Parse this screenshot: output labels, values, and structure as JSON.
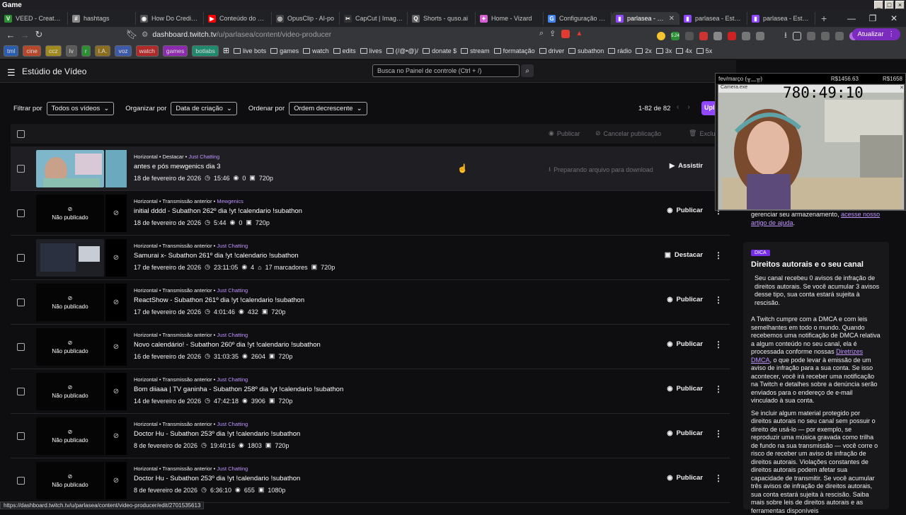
{
  "window": {
    "title": "Game"
  },
  "tabs": [
    {
      "label": "VEED - Create, Ed",
      "icon_color": "#2c8f34",
      "glyph": "V"
    },
    {
      "label": "hashtags",
      "icon_color": "#888888",
      "glyph": "#"
    },
    {
      "label": "How Do Credits W",
      "icon_color": "#555555",
      "glyph": "◉"
    },
    {
      "label": "Conteúdo do can",
      "icon_color": "#ff0000",
      "glyph": "▶"
    },
    {
      "label": "OpusClip - AI-po",
      "icon_color": "#444444",
      "glyph": "◎"
    },
    {
      "label": "CapCut | Image E",
      "icon_color": "#333333",
      "glyph": "✂"
    },
    {
      "label": "Shorts - quso.ai",
      "icon_color": "#666666",
      "glyph": "Q"
    },
    {
      "label": "Home - Vizard",
      "icon_color": "#d45fd4",
      "glyph": "✦"
    },
    {
      "label": "Configuração Me",
      "icon_color": "#4285f4",
      "glyph": "G"
    },
    {
      "label": "parlasea - Estú",
      "icon_color": "#9147ff",
      "glyph": "▮",
      "active": true
    },
    {
      "label": "parlasea - Estúdio",
      "icon_color": "#9147ff",
      "glyph": "▮"
    },
    {
      "label": "parlasea - Estúdio",
      "icon_color": "#9147ff",
      "glyph": "▮"
    }
  ],
  "address": {
    "host": "dashboard.twitch.tv",
    "path": "/u/parlasea/content/video-producer",
    "update_label": "Atualizar",
    "badge": "5.24"
  },
  "bookmarks": {
    "chips": [
      "tml",
      "cine",
      "ccz",
      "lv",
      "r",
      "I.A.",
      "voz",
      "watch",
      "games",
      "botlabs"
    ],
    "items": [
      "live bots",
      "games",
      "watch",
      "edits",
      "lives",
      "(/@•@)/",
      "donate $",
      "stream",
      "formatação",
      "driver",
      "subathon",
      "rádio",
      "2x",
      "3x",
      "4x",
      "5x"
    ]
  },
  "header": {
    "title": "Estúdio de Vídeo",
    "search_placeholder": "Busca no Painel de controle (Ctrl + /)"
  },
  "filters": {
    "filter_label": "Filtrar por",
    "filter_value": "Todos os vídeos",
    "organize_label": "Organizar por",
    "organize_value": "Data de criação",
    "order_label": "Ordenar por",
    "order_value": "Ordem decrescente",
    "page_count": "1-82 de 82",
    "upload_label": "Upl"
  },
  "bulk_actions": {
    "publish": "Publicar",
    "unpublish": "Cancelar publicação",
    "delete": "Exclu"
  },
  "videos": [
    {
      "category": "Horizontal • Destacar •",
      "game": "Just Chatting",
      "title": "antes e pós mewgenics dia 3",
      "date": "18 de fevereiro de 2026",
      "duration": "15:46",
      "views": "0",
      "markers": "",
      "quality": "720p",
      "action": "Assistir",
      "prep": "Preparando arquivo para download",
      "published": true
    },
    {
      "category": "Horizontal • Transmissão anterior •",
      "game": "Mewgenics",
      "title": "initial dddd - Subathon 262º dia !yt !calendario !subathon",
      "date": "18 de fevereiro de 2026",
      "duration": "5:44",
      "views": "0",
      "markers": "",
      "quality": "720p",
      "action": "Publicar",
      "published": false
    },
    {
      "category": "Horizontal • Transmissão anterior •",
      "game": "Just Chatting",
      "title": "Samurai x- Subathon 261º dia !yt !calendario !subathon",
      "date": "17 de fevereiro de 2026",
      "duration": "23:11:05",
      "views": "4",
      "markers": "17 marcadores",
      "quality": "720p",
      "action": "Destacar",
      "published": true
    },
    {
      "category": "Horizontal • Transmissão anterior •",
      "game": "Just Chatting",
      "title": "ReactShow - Subathon 261º dia !yt !calendario !subathon",
      "date": "17 de fevereiro de 2026",
      "duration": "4:01:46",
      "views": "432",
      "markers": "",
      "quality": "720p",
      "action": "Publicar",
      "published": false
    },
    {
      "category": "Horizontal • Transmissão anterior •",
      "game": "Just Chatting",
      "title": "Novo calendário! - Subathon 260º dia !yt !calendario !subathon",
      "date": "16 de fevereiro de 2026",
      "duration": "31:03:35",
      "views": "2604",
      "markers": "",
      "quality": "720p",
      "action": "Publicar",
      "published": false
    },
    {
      "category": "Horizontal • Transmissão anterior •",
      "game": "Just Chatting",
      "title": "Bom diiaaa | TV ganinha - Subathon 258º dia !yt !calendario !subathon",
      "date": "14 de fevereiro de 2026",
      "duration": "47:42:18",
      "views": "3906",
      "markers": "",
      "quality": "720p",
      "action": "Publicar",
      "published": false
    },
    {
      "category": "Horizontal • Transmissão anterior •",
      "game": "Just Chatting",
      "title": "Doctor Hu - Subathon 253º dia !yt !calendario !subathon",
      "date": "8 de fevereiro de 2026",
      "duration": "19:40:16",
      "views": "1803",
      "markers": "",
      "quality": "720p",
      "action": "Publicar",
      "published": false
    },
    {
      "category": "Horizontal • Transmissão anterior •",
      "game": "Just Chatting",
      "title": "Doctor Hu - Subathon 253º dia !yt !calendario !subathon",
      "date": "8 de fevereiro de 2026",
      "duration": "6:36:10",
      "views": "655",
      "markers": "",
      "quality": "1080p",
      "action": "Publicar",
      "published": false
    }
  ],
  "unpublished_label": "Não publicado",
  "side_panel": {
    "storage_text": "gerenciar seu armazenamento,",
    "storage_link": "acesse nosso artigo de ajuda",
    "tip_badge": "DICA",
    "title": "Direitos autorais e o seu canal",
    "p1": "Seu canal recebeu 0 avisos de infração de direitos autorais. Se você acumular 3 avisos desse tipo, sua conta estará sujeita à rescisão.",
    "p2a": "A Twitch cumpre com a DMCA e com leis semelhantes em todo o mundo. Quando recebemos uma notificação de DMCA relativa a algum conteúdo no seu canal, ela é processada conforme nossas",
    "p2link": "Diretrizes DMCA",
    "p2b": ", o que pode levar à emissão de um aviso de infração para a sua conta. Se isso acontecer, você irá receber uma notificação na Twitch e detalhes sobre a denúncia serão enviados para o endereço de e-mail vinculado à sua conta.",
    "p3": "Se incluir algum material protegido por direitos autorais no seu canal sem possuir o direito de usá-lo — por exemplo, se reproduzir uma música gravada como trilha de fundo na sua transmissão — você corre o risco de receber um aviso de infração de direitos autorais. Violações constantes de direitos autorais podem afetar sua capacidade de transmitir. Se você acumular três avisos de infração de direitos autorais, sua conta estará sujeita à rescisão. Saiba mais sobre leis de direitos autorais e as ferramentas disponíveis"
  },
  "overlay": {
    "label": "fev/março (╥﹏╥)",
    "amount1": "R$1456.63",
    "amount2": "R$1658",
    "cam_title": "Camera.exe",
    "timer": "780:49:10"
  },
  "status_url": "https://dashboard.twitch.tv/u/parlasea/content/video-producer/edit/2701535613"
}
